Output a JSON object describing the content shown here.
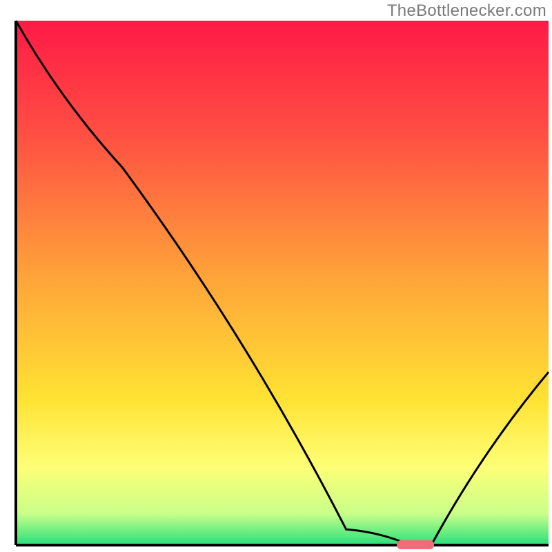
{
  "watermark_text": "TheBottlenecker.com",
  "chart_data": {
    "type": "line",
    "title": "",
    "xlabel": "",
    "ylabel": "",
    "xlim": [
      0,
      100
    ],
    "ylim": [
      0,
      100
    ],
    "series": [
      {
        "name": "bottleneck-curve",
        "x": [
          0,
          20,
          62,
          74,
          78,
          100
        ],
        "y": [
          100,
          72,
          3,
          0,
          0,
          33
        ],
        "description": "Percent bottleneck (y) vs. normalized hardware position (x). A steep drop from 100% at x=0, a visible inflection near x≈20, descending to ~0% around x≈70–78 (the optimal zone), then rising again to ~33% by x=100."
      }
    ],
    "highlight": {
      "start_x": 71.5,
      "end_x": 78.5,
      "color": "#ef6d77",
      "description": "Sweet-spot bar on x-axis where bottleneck is minimal."
    },
    "gradient_stops": [
      {
        "pct": 0,
        "color": "#ff1a46"
      },
      {
        "pct": 22,
        "color": "#ff5043"
      },
      {
        "pct": 50,
        "color": "#ffa739"
      },
      {
        "pct": 72,
        "color": "#ffe233"
      },
      {
        "pct": 85,
        "color": "#feff76"
      },
      {
        "pct": 94,
        "color": "#c9ff89"
      },
      {
        "pct": 100,
        "color": "#26e07c"
      }
    ],
    "axis_color": "#000000",
    "curve_color": "#000000",
    "description": "A square plot with a vivid red→orange→yellow→green vertical gradient as background (good toward the bottom) and a black curve showing bottleneck percentage dropping to an optimum zone highlighted with a small pink bar on the x-axis, then rising again."
  }
}
